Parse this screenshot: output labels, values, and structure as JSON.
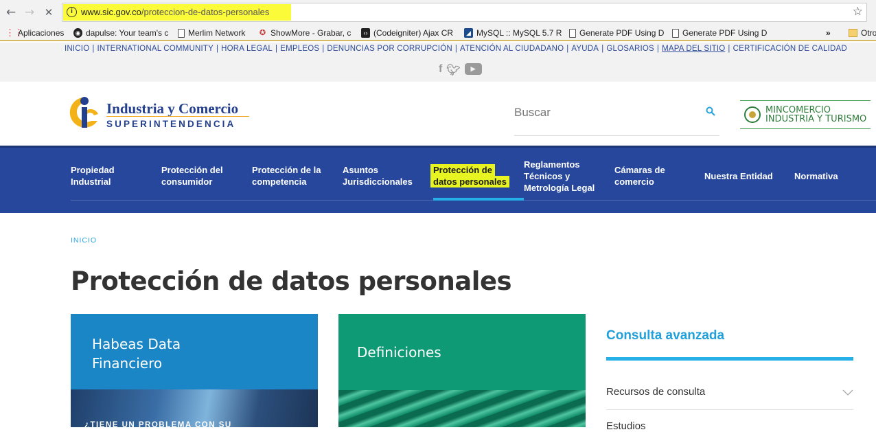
{
  "browser": {
    "url_host": "www.sic.gov.co",
    "url_path": "/proteccion-de-datos-personales",
    "bookmarks": [
      {
        "label": "Aplicaciones",
        "icon": "apps-grid-icon"
      },
      {
        "label": "dapulse: Your team's c",
        "icon": "dapulse-icon"
      },
      {
        "label": "Merlim Network",
        "icon": "page-icon"
      },
      {
        "label": "ShowMore - Grabar, c",
        "icon": "showmore-icon"
      },
      {
        "label": "(Codeigniter) Ajax CR",
        "icon": "code-icon"
      },
      {
        "label": "MySQL :: MySQL 5.7 R",
        "icon": "mysql-icon"
      },
      {
        "label": "Generate PDF Using D",
        "icon": "page-icon"
      },
      {
        "label": "Generate PDF Using D",
        "icon": "page-icon"
      }
    ],
    "overflow": "»",
    "other_folder": "Otro"
  },
  "util_links": [
    "INICIO",
    "INTERNATIONAL COMMUNITY",
    "HORA LEGAL",
    "EMPLEOS",
    "DENUNCIAS POR CORRUPCIÓN",
    "ATENCIÓN AL CIUDADANO",
    "AYUDA",
    "GLOSARIOS",
    "MAPA DEL SITIO",
    "CERTIFICACIÓN DE CALIDAD"
  ],
  "header": {
    "logo_line1": "Industria y Comercio",
    "logo_line2": "SUPERINTENDENCIA",
    "search_placeholder": "Buscar",
    "mincom_line1": "MINCOMERCIO",
    "mincom_line2": "INDUSTRIA Y TURISMO"
  },
  "nav": [
    {
      "l1": "Propiedad",
      "l2": "Industrial",
      "l3": ""
    },
    {
      "l1": "Protección del",
      "l2": "consumidor",
      "l3": ""
    },
    {
      "l1": "Protección de la",
      "l2": "competencia",
      "l3": ""
    },
    {
      "l1": "Asuntos",
      "l2": "Jurisdiccionales",
      "l3": ""
    },
    {
      "l1": "Protección de",
      "l2": "datos personales",
      "l3": "",
      "active": true
    },
    {
      "l1": "Reglamentos",
      "l2": "Técnicos y",
      "l3": "Metrología Legal"
    },
    {
      "l1": "Cámaras de",
      "l2": "comercio",
      "l3": ""
    },
    {
      "l1": "Nuestra Entidad",
      "l2": "",
      "l3": ""
    },
    {
      "l1": "Normativa",
      "l2": "",
      "l3": ""
    }
  ],
  "breadcrumb": "INICIO",
  "page_title": "Protección de datos personales",
  "cards": [
    {
      "title_l1": "Habeas Data",
      "title_l2": "Financiero",
      "teaser": "¿TIENE UN PROBLEMA CON SU"
    },
    {
      "title": "Definiciones"
    }
  ],
  "sidebar": {
    "title": "Consulta avanzada",
    "items": [
      "Recursos de consulta",
      "Estudios"
    ]
  },
  "colors": {
    "nav_bg": "#27479d",
    "accent": "#26b0e8",
    "highlight": "#e7f421"
  }
}
